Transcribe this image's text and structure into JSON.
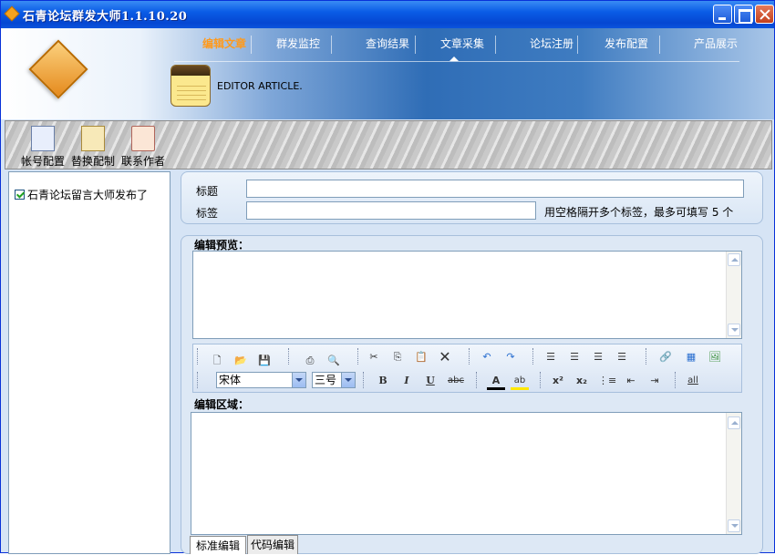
{
  "window": {
    "title": "石青论坛群发大师1.1.10.20",
    "controls": {
      "minimize": "minimize",
      "maximize": "maximize",
      "close": "close"
    }
  },
  "nav": {
    "items": [
      {
        "label": "编辑文章",
        "active": true
      },
      {
        "label": "群发监控"
      },
      {
        "label": "查询结果"
      },
      {
        "label": "文章采集"
      },
      {
        "label": "论坛注册"
      },
      {
        "label": "发布配置"
      },
      {
        "label": "产品展示"
      }
    ]
  },
  "header": {
    "subtitle": "EDITOR ARTICLE."
  },
  "toolbar": {
    "buttons": [
      {
        "label": "帐号配置",
        "icon": "account-config-icon"
      },
      {
        "label": "替换配制",
        "icon": "replace-config-icon"
      },
      {
        "label": "联系作者",
        "icon": "contact-author-icon"
      }
    ]
  },
  "tree": {
    "items": [
      {
        "label": "石青论坛留言大师发布了",
        "checked": true
      }
    ]
  },
  "form": {
    "title_label": "标题",
    "title_value": "",
    "tags_label": "标签",
    "tags_value": "",
    "tags_hint": "用空格隔开多个标签，最多可填写 5 个"
  },
  "editor": {
    "preview_label": "编辑预览：",
    "edit_label": "编辑区域：",
    "font_family": "宋体",
    "font_size": "三号",
    "bold": "B",
    "italic": "I",
    "underline": "U",
    "strike": "abc",
    "font_color": "A",
    "highlight": "ab",
    "superscript": "x²",
    "subscript": "x₂",
    "clean": "all"
  },
  "tabs": [
    {
      "label": "标准编辑",
      "active": true
    },
    {
      "label": "代码编辑"
    }
  ],
  "colors": {
    "accent": "#ff9a1c",
    "title_bar": "#0a5ce6",
    "panel": "#dde8f5"
  }
}
